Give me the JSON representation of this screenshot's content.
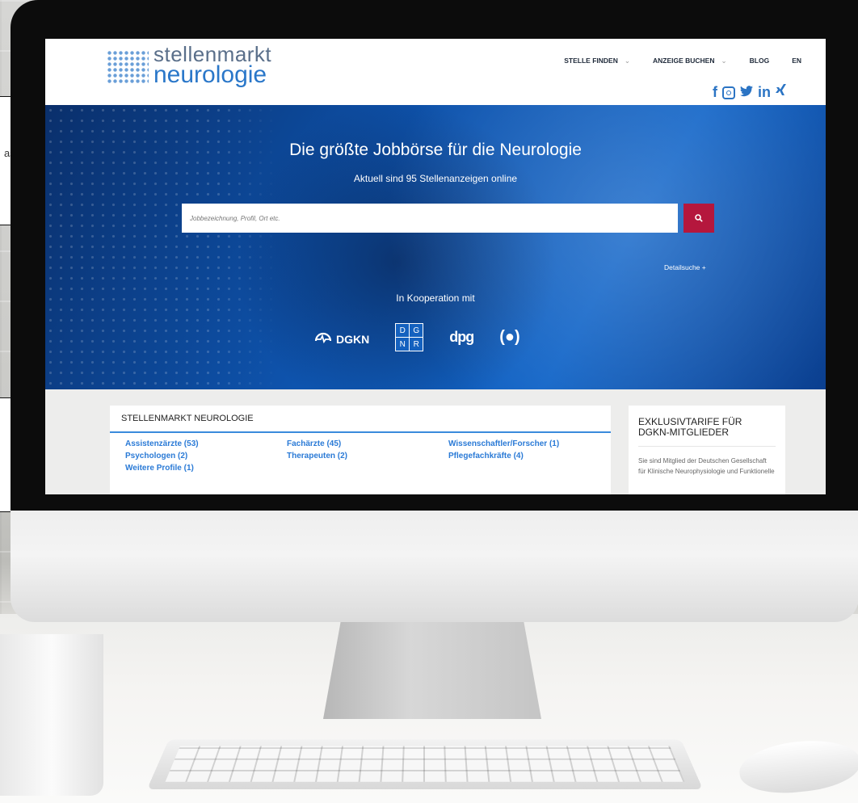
{
  "brand": {
    "line1": "stellenmarkt",
    "line2": "neurologie"
  },
  "nav": {
    "items": [
      {
        "label": "STELLE FINDEN",
        "has_dropdown": true
      },
      {
        "label": "ANZEIGE BUCHEN",
        "has_dropdown": true
      },
      {
        "label": "BLOG",
        "has_dropdown": false
      },
      {
        "label": "EN",
        "has_dropdown": false
      }
    ],
    "caret": "⌄"
  },
  "social": {
    "facebook": "f",
    "twitter": "🐦",
    "linkedin": "in",
    "xing": "ᵡ"
  },
  "hero": {
    "title": "Die größte Jobbörse für die Neurologie",
    "subtitle": "Aktuell sind 95 Stellenanzeigen online",
    "search_placeholder": "Jobbezeichnung, Profil, Ort etc.",
    "detail_search": "Detailsuche +",
    "cooperation": "In Kooperation mit",
    "partners": {
      "dgkn": "DGKN",
      "dgnr": [
        "D",
        "G",
        "N",
        "R"
      ],
      "dpg": "dpg",
      "fourth": "(●)"
    }
  },
  "jobs": {
    "heading": "STELLENMARKT NEUROLOGIE",
    "categories": [
      "Assistenzärzte (53)",
      "Fachärzte (45)",
      "Wissenschaftler/Forscher (1)",
      "Psychologen (2)",
      "Therapeuten (2)",
      "Pflegefachkräfte (4)",
      "Weitere Profile (1)"
    ]
  },
  "aside": {
    "title": "EXKLUSIVTARIFE FÜR DGKN-MITGLIEDER",
    "text": "Sie sind Mitglied der Deutschen Gesellschaft für Klinische Neurophysiologie und Funktionelle"
  },
  "side_note": {
    "text": "as"
  },
  "colors": {
    "accent_blue": "#2a7ad6",
    "search_button": "#b5173d",
    "hero_blue": "#1265c8"
  }
}
